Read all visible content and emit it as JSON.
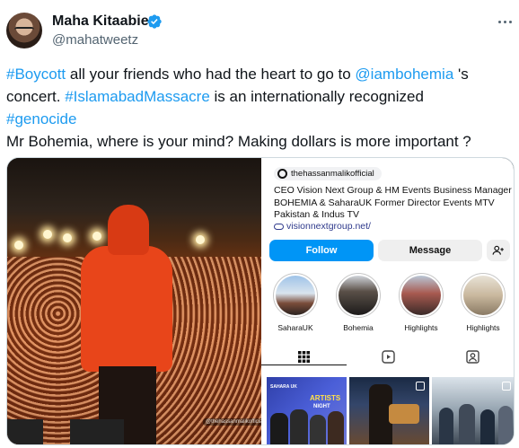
{
  "tweet": {
    "author_name": "Maha Kitaabie",
    "author_handle": "@mahatweetz",
    "text_lines": [
      [
        {
          "text": "#Boycott",
          "type": "link"
        },
        {
          "text": " all your friends who had the heart to go to ",
          "type": "text"
        },
        {
          "text": "@iambohemia",
          "type": "link"
        },
        {
          "text": " 's",
          "type": "text"
        }
      ],
      [
        {
          "text": "concert. ",
          "type": "text"
        },
        {
          "text": "#IslamabadMassacre",
          "type": "link"
        },
        {
          "text": " is an internationally recognized",
          "type": "text"
        }
      ],
      [
        {
          "text": "#genocide",
          "type": "link"
        }
      ],
      [
        {
          "text": "Mr Bohemia, where is your mind? Making dollars is more important ?",
          "type": "text"
        }
      ]
    ]
  },
  "media": {
    "photo_watermark": "@thehassanmalikofficial",
    "profile": {
      "username": "thehassanmalikofficial",
      "bio_lines": [
        "CEO Vision Next Group & HM Events Business Manager",
        "BOHEMIA & SaharaUK Former Director Events MTV",
        "Pakistan & Indus TV"
      ],
      "website": "visionnextgroup.net/",
      "follow_label": "Follow",
      "message_label": "Message",
      "highlights": [
        {
          "label": "SaharaUK"
        },
        {
          "label": "Bohemia"
        },
        {
          "label": "Highlights"
        },
        {
          "label": "Highlights"
        }
      ],
      "post1_text": [
        "SAHARA UK",
        "ARTISTS",
        "NIGHT"
      ]
    }
  },
  "colors": {
    "link": "#1d9bf0",
    "verified": "#1d9bf0",
    "follow_button": "#0095f6",
    "muted_text": "#536471"
  },
  "icons": {
    "verified": "verified-badge-icon",
    "more": "more-icon",
    "threads": "threads-icon",
    "website": "link-icon",
    "add_user": "add-user-icon",
    "grid_tab": "grid-icon",
    "reels_tab": "reels-icon",
    "tagged_tab": "tagged-icon"
  }
}
